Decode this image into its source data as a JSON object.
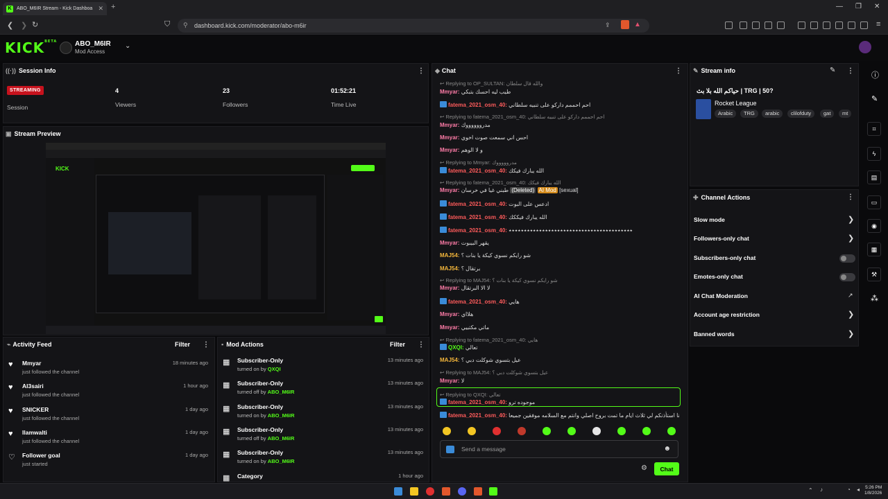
{
  "browser": {
    "tab_title": "ABO_M6IR Stream - Kick Dashboa",
    "url": "dashboard.kick.com/moderator/abo-m6ir"
  },
  "header": {
    "logo": "KICK",
    "logo_sup": "BETA",
    "channel_name": "ABO_M6IR",
    "channel_role": "Mod Access"
  },
  "session": {
    "title": "Session Info",
    "status": "STREAMING",
    "status_label": "Session",
    "viewers": "4",
    "viewers_label": "Viewers",
    "followers": "23",
    "followers_label": "Followers",
    "time_live": "01:52:21",
    "time_live_label": "Time Live"
  },
  "preview": {
    "title": "Stream Preview"
  },
  "activity": {
    "title": "Activity Feed",
    "filter": "Filter",
    "items": [
      {
        "name": "Mmyar",
        "sub": "just followed the channel",
        "time": "18 minutes ago"
      },
      {
        "name": "Al3sairi",
        "sub": "just followed the channel",
        "time": "1 hour ago"
      },
      {
        "name": "SNICKER",
        "sub": "just followed the channel",
        "time": "1 day ago"
      },
      {
        "name": "Ilamwalti",
        "sub": "just followed the channel",
        "time": "1 day ago"
      },
      {
        "name": "Follower goal",
        "sub": "just started",
        "time": "1 day ago"
      }
    ]
  },
  "modactions": {
    "title": "Mod Actions",
    "filter": "Filter",
    "items": [
      {
        "name": "Subscriber-Only",
        "sub": "turned on by",
        "user": "QXQI",
        "time": "13 minutes ago"
      },
      {
        "name": "Subscriber-Only",
        "sub": "turned off by",
        "user": "ABO_M6IR",
        "time": "13 minutes ago"
      },
      {
        "name": "Subscriber-Only",
        "sub": "turned on by",
        "user": "ABO_M6IR",
        "time": "13 minutes ago"
      },
      {
        "name": "Subscriber-Only",
        "sub": "turned off by",
        "user": "ABO_M6IR",
        "time": "13 minutes ago"
      },
      {
        "name": "Subscriber-Only",
        "sub": "turned on by",
        "user": "ABO_M6IR",
        "time": "13 minutes ago"
      },
      {
        "name": "Category",
        "sub": "",
        "user": "",
        "time": "1 hour ago"
      }
    ]
  },
  "chat": {
    "title": "Chat",
    "placeholder": "Send a message",
    "send": "Chat",
    "lines": [
      {
        "reply": "Replying to OP_SULTAN: والله قال سلطان"
      },
      {
        "user": "Mmyar",
        "cls": "u-m",
        "msg": "طيب ليه احسك بتبكي"
      },
      {
        "user": "fatema_2021_osm_40",
        "cls": "u-f",
        "pfx": true,
        "msg": "احم احممم داركو على تنبيه سلطاني"
      },
      {
        "reply": "Replying to fatema_2021_osm_40: احم احممم داركو على تنبيه سلطاني"
      },
      {
        "user": "Mmyar",
        "cls": "u-m",
        "msg": "مدرووووووك"
      },
      {
        "user": "Mmyar",
        "cls": "u-m",
        "msg": "احس اني سمعت صوت اخوي"
      },
      {
        "user": "Mmyar",
        "cls": "u-m",
        "msg": "و لا الوهم"
      },
      {
        "reply": "Replying to Mmyar: مدروووووك"
      },
      {
        "user": "fatema_2021_osm_40",
        "cls": "u-f",
        "pfx": true,
        "msg": "الله يبارك فيكك"
      },
      {
        "reply": "Replying to fatema_2021_osm_40: الله يبارك فيكك"
      },
      {
        "user": "Mmyar",
        "cls": "u-m",
        "msg": "طبني غيا في خرسان",
        "deleted": "(Deleted)",
        "aimod": "AI Mod",
        "flag": "[sexual]"
      },
      {
        "user": "fatema_2021_osm_40",
        "cls": "u-f",
        "pfx": true,
        "msg": "ادعس على البوت"
      },
      {
        "user": "fatema_2021_osm_40",
        "cls": "u-f",
        "pfx": true,
        "msg": "الله يبارك فيككك"
      },
      {
        "user": "fatema_2021_osm_40",
        "cls": "u-f",
        "pfx": true,
        "msg": "٭٭٭٭٭٭٭٭٭٭٭٭٭٭٭٭٭٭٭٭٭٭٭٭٭٭٭٭٭٭٭٭٭٭٭٭٭٭٭٭٭"
      },
      {
        "user": "Mmyar",
        "cls": "u-m",
        "msg": "يقهر البيبوت"
      },
      {
        "user": "MAJ54",
        "cls": "u-j",
        "msg": "شو رايكم نسوي كيكة يا بنات ؟"
      },
      {
        "user": "MAJ54",
        "cls": "u-j",
        "msg": "برتقال ؟"
      },
      {
        "reply": "Replying to MAJ54: شو رايكم نسوي كيكة يا بنات ؟"
      },
      {
        "user": "Mmyar",
        "cls": "u-m",
        "msg": "لا الا البرتقال"
      },
      {
        "user": "fatema_2021_osm_40",
        "cls": "u-f",
        "pfx": true,
        "msg": "هايي"
      },
      {
        "user": "Mmyar",
        "cls": "u-m",
        "msg": "هلااي"
      },
      {
        "user": "Mmyar",
        "cls": "u-m",
        "msg": "ماتي مكتبيي"
      },
      {
        "reply": "Replying to fatema_2021_osm_40: هايي"
      },
      {
        "user": "QXQI",
        "cls": "u-q",
        "pfx": true,
        "msg": "تعالي"
      },
      {
        "user": "MAJ54",
        "cls": "u-j",
        "msg": "عيل بتسوي شوكلت دبي ؟"
      },
      {
        "reply": "Replying to MAJ54: عيل بتسوي شوكلت دبي ؟"
      },
      {
        "user": "Mmyar",
        "cls": "u-m",
        "msg": "لا"
      },
      {
        "reply": "Replying to QXQI: تعالي"
      },
      {
        "user": "fatema_2021_osm_40",
        "cls": "u-f",
        "pfx": true,
        "msg": "موجوده ترو"
      },
      {
        "user": "fatema_2021_osm_40",
        "cls": "u-f",
        "pfx": true,
        "msg": "انا استأذنكم لي ثلاث ايام ما تمت بروح اصلي وانتم مع السلامه موفقين جميعا"
      }
    ],
    "emote_colors": [
      "#f3c623",
      "#f3c623",
      "#e03030",
      "#c0392b",
      "#53fc18",
      "#53fc18",
      "#e6e6e6",
      "#53fc18",
      "#53fc18",
      "#53fc18"
    ]
  },
  "streaminfo": {
    "title": "Stream info",
    "stream_title": "حياكم الله بلا بث | TRG | 50?",
    "category": "Rocket League",
    "tags": [
      "Arabic",
      "TRG",
      "arabic",
      "clilofduty",
      "gat",
      "mt"
    ]
  },
  "channelactions": {
    "title": "Channel Actions",
    "items": [
      {
        "label": "Slow mode",
        "kind": "arrow"
      },
      {
        "label": "Followers-only chat",
        "kind": "arrow"
      },
      {
        "label": "Subscribers-only chat",
        "kind": "toggle"
      },
      {
        "label": "Emotes-only chat",
        "kind": "toggle"
      },
      {
        "label": "AI Chat Moderation",
        "kind": "external"
      },
      {
        "label": "Account age restriction",
        "kind": "arrow"
      },
      {
        "label": "Banned words",
        "kind": "arrow"
      }
    ]
  },
  "taskbar": {
    "time": "5:26 PM",
    "date": "1/8/2026"
  },
  "colors": {
    "brand": "#53fc18",
    "streaming": "#c7121d",
    "panel": "#141417"
  }
}
